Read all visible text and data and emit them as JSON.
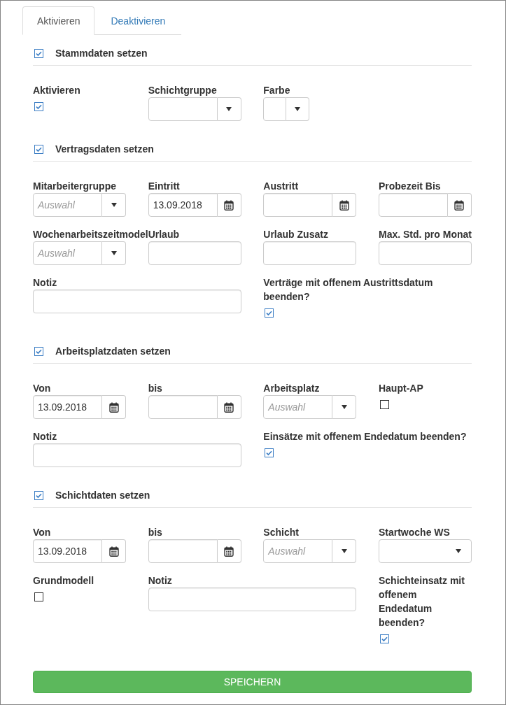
{
  "tabs": [
    {
      "label": "Aktivieren",
      "selected": true
    },
    {
      "label": "Deaktivieren",
      "selected": false
    }
  ],
  "sections": [
    {
      "title": "Stammdaten setzen",
      "checked": true,
      "fields": [
        {
          "kind": "checkbox",
          "label": "Aktivieren",
          "checked": true
        },
        {
          "kind": "select",
          "label": "Schichtgruppe"
        },
        {
          "kind": "color-select",
          "label": "Farbe"
        }
      ]
    },
    {
      "title": "Vertragsdaten setzen",
      "checked": true,
      "fields": [
        {
          "kind": "select",
          "label": "Mitarbeitergruppe",
          "placeholder": "Auswahl"
        },
        {
          "kind": "date",
          "label": "Eintritt",
          "value": "13.09.2018"
        },
        {
          "kind": "date",
          "label": "Austritt"
        },
        {
          "kind": "date",
          "label": "Probezeit Bis"
        },
        {
          "kind": "select",
          "label": "Wochenarbeitszeitmodel",
          "placeholder": "Auswahl"
        },
        {
          "kind": "text",
          "label": "Urlaub"
        },
        {
          "kind": "text",
          "label": "Urlaub Zusatz"
        },
        {
          "kind": "text",
          "label": "Max. Std. pro Monat"
        },
        {
          "kind": "wide-text",
          "label": "Notiz"
        },
        {
          "kind": "wide-checkbox",
          "label": "Verträge mit offenem Austrittsdatum beenden?",
          "checked": true
        }
      ]
    },
    {
      "title": "Arbeitsplatzdaten setzen",
      "checked": true,
      "fields": [
        {
          "kind": "date",
          "label": "Von",
          "value": "13.09.2018"
        },
        {
          "kind": "date",
          "label": "bis"
        },
        {
          "kind": "select",
          "label": "Arbeitsplatz",
          "placeholder": "Auswahl"
        },
        {
          "kind": "checkbox",
          "label": "Haupt-AP",
          "checked": false
        },
        {
          "kind": "wide-text",
          "label": "Notiz"
        },
        {
          "kind": "wide-checkbox",
          "label": "Einsätze mit offenem Endedatum beenden?",
          "checked": true
        }
      ]
    },
    {
      "title": "Schichtdaten setzen",
      "checked": true,
      "fields": [
        {
          "kind": "date",
          "label": "Von",
          "value": "13.09.2018"
        },
        {
          "kind": "date",
          "label": "bis"
        },
        {
          "kind": "select",
          "label": "Schicht",
          "placeholder": "Auswahl"
        },
        {
          "kind": "dropdown",
          "label": "Startwoche WS"
        },
        {
          "kind": "checkbox",
          "label": "Grundmodell",
          "checked": false
        },
        {
          "kind": "wide-text",
          "label": "Notiz"
        },
        {
          "kind": "checkbox",
          "label": "Schichteinsatz mit offenem Endedatum beenden?",
          "checked": true
        }
      ]
    }
  ],
  "save_button": {
    "label": "SPEICHERN"
  }
}
